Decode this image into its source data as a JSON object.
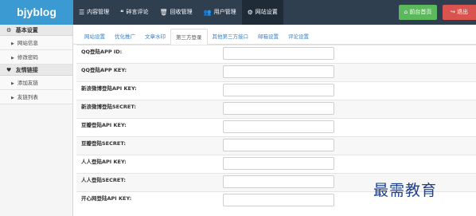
{
  "brand": "bjyblog",
  "nav": [
    {
      "icon": "☰",
      "icon_name": "list-icon",
      "label": "内容管理"
    },
    {
      "icon": "❝",
      "icon_name": "comment-icon",
      "label": "碎言评论"
    },
    {
      "icon": "🗑",
      "icon_name": "trash-icon",
      "label": "回收管理"
    },
    {
      "icon": "👥",
      "icon_name": "users-icon",
      "label": "用户管理"
    },
    {
      "icon": "⚙",
      "icon_name": "gears-icon",
      "label": "网站设置"
    }
  ],
  "header_buttons": {
    "home": "前台首页",
    "home_icon": "⌂",
    "logout": "退出",
    "logout_icon": "↪"
  },
  "sidebar": {
    "groups": [
      {
        "icon": "⚙",
        "label": "基本设置",
        "items": [
          "网站信息",
          "修改密码"
        ]
      },
      {
        "icon": "♥",
        "label": "友情链接",
        "items": [
          "添加友链",
          "友链列表"
        ]
      }
    ]
  },
  "tabs": [
    "网站设置",
    "优化推广",
    "文章水印",
    "第三方登录",
    "其他第三方接口",
    "邮箱设置",
    "评论设置"
  ],
  "active_tab": 3,
  "fields": [
    {
      "label": "QQ登陆APP ID:",
      "value": ""
    },
    {
      "label": "QQ登陆APP KEY:",
      "value": ""
    },
    {
      "label": "新浪微博登陆API KEY:",
      "value": ""
    },
    {
      "label": "新浪微博登陆SECRET:",
      "value": ""
    },
    {
      "label": "豆瓣登陆API KEY:",
      "value": ""
    },
    {
      "label": "豆瓣登陆SECRET:",
      "value": ""
    },
    {
      "label": "人人登陆API KEY:",
      "value": ""
    },
    {
      "label": "人人登陆SECRET:",
      "value": ""
    },
    {
      "label": "开心网登陆API KEY:",
      "value": ""
    }
  ],
  "watermark": "最需教育",
  "colors": {
    "topbar": "#2f3f4f",
    "brand_bg": "#3a9ad1",
    "home_button": "#5cb85c",
    "logout_button": "#d9534f",
    "tab_link": "#3a7fc1"
  }
}
